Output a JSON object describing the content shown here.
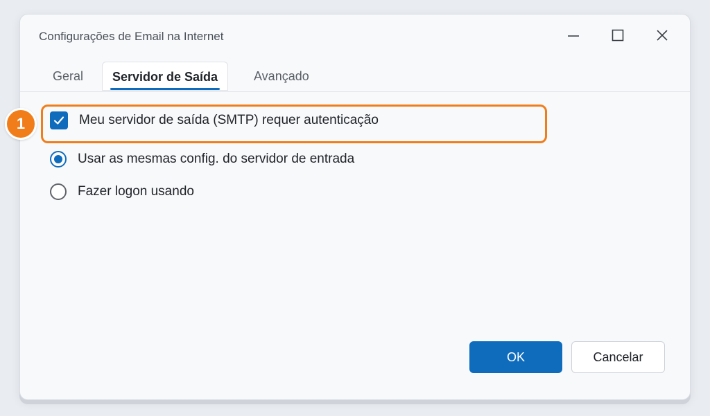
{
  "window": {
    "title": "Configurações de Email na Internet",
    "controls": [
      "minimize-icon",
      "maximize-icon",
      "close-icon"
    ]
  },
  "tabs": [
    {
      "label": "Geral",
      "active": false
    },
    {
      "label": "Servidor de Saída",
      "active": true
    },
    {
      "label": "Avançado",
      "active": false
    }
  ],
  "options": {
    "smtp_auth": {
      "label": "Meu servidor de saída (SMTP) requer autenticação",
      "checked": true
    },
    "same_settings": {
      "label": "Usar as mesmas config. do servidor de entrada",
      "selected": true
    },
    "logon_using": {
      "label": "Fazer logon usando",
      "selected": false
    }
  },
  "annotation": {
    "step": "1"
  },
  "buttons": {
    "ok": "OK",
    "cancel": "Cancelar"
  },
  "colors": {
    "accent": "#0f6cbd",
    "highlight": "#f07d1a"
  }
}
